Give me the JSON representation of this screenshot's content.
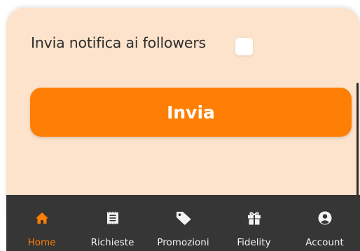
{
  "form": {
    "notify_label": "Invia notifica ai followers",
    "notify_checked": false,
    "submit_label": "Invia"
  },
  "bottom_nav": {
    "items": [
      {
        "label": "Home",
        "icon": "home-icon",
        "active": true
      },
      {
        "label": "Richieste",
        "icon": "receipt-icon",
        "active": false
      },
      {
        "label": "Promozioni",
        "icon": "tag-icon",
        "active": false
      },
      {
        "label": "Fidelity",
        "icon": "gift-icon",
        "active": false
      },
      {
        "label": "Account",
        "icon": "account-circle-icon",
        "active": false
      }
    ]
  },
  "colors": {
    "accent": "#fe7f03",
    "card_background": "#fde3cb",
    "nav_background": "#363636",
    "nav_text": "#f3f3f3"
  }
}
